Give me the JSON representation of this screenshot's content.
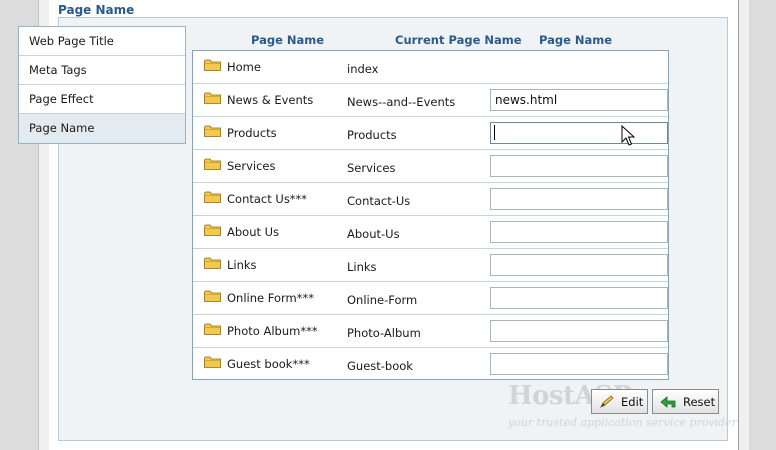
{
  "section_title": "Page Name",
  "tabs": [
    {
      "label": "Web Page Title",
      "active": false
    },
    {
      "label": "Meta Tags",
      "active": false
    },
    {
      "label": "Page Effect",
      "active": false
    },
    {
      "label": "Page Name",
      "active": true
    }
  ],
  "columns": {
    "page_name": "Page Name",
    "current_page_name": "Current Page Name",
    "new_page_name": "Page Name"
  },
  "rows": [
    {
      "page": "Home",
      "current": "index",
      "value": "",
      "has_field": false
    },
    {
      "page": "News & Events",
      "current": "News--and--Events",
      "value": "news.html",
      "has_field": true
    },
    {
      "page": "Products",
      "current": "Products",
      "value": "",
      "has_field": true,
      "focused": true
    },
    {
      "page": "Services",
      "current": "Services",
      "value": "",
      "has_field": true
    },
    {
      "page": "Contact Us***",
      "current": "Contact-Us",
      "value": "",
      "has_field": true
    },
    {
      "page": "About Us",
      "current": "About-Us",
      "value": "",
      "has_field": true
    },
    {
      "page": "Links",
      "current": "Links",
      "value": "",
      "has_field": true
    },
    {
      "page": "Online Form***",
      "current": "Online-Form",
      "value": "",
      "has_field": true
    },
    {
      "page": "Photo Album***",
      "current": "Photo-Album",
      "value": "",
      "has_field": true
    },
    {
      "page": "Guest book***",
      "current": "Guest-book",
      "value": "",
      "has_field": true
    }
  ],
  "buttons": {
    "edit_label": "Edit",
    "reset_label": "Reset"
  },
  "watermark": {
    "logo": "HostASP",
    "tagline": "your trusted application service provider"
  },
  "icons": {
    "row_icon": "folder-icon",
    "edit_icon": "pencil-icon",
    "reset_icon": "undo-arrow-icon",
    "pointer": "mouse-pointer-icon"
  },
  "colors": {
    "header_text": "#2a5a8c",
    "folder": "#f2c94c",
    "reset_arrow": "#2e9e3e"
  }
}
